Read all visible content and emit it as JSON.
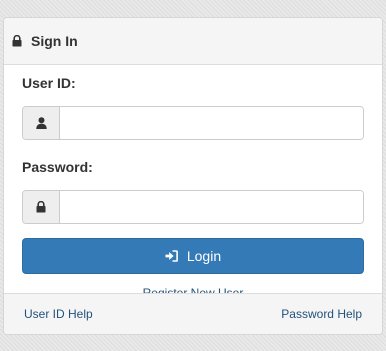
{
  "panel": {
    "title": "Sign In",
    "title_icon": "lock-icon"
  },
  "form": {
    "user_id_label": "User ID:",
    "user_id_value": "",
    "user_id_icon": "user-icon",
    "password_label": "Password:",
    "password_value": "",
    "password_icon": "lock-icon",
    "login_label": "Login",
    "login_icon": "sign-in-icon",
    "register_link": "Register New User"
  },
  "footer": {
    "user_id_help": "User ID Help",
    "password_help": "Password Help"
  },
  "colors": {
    "primary": "#337ab7",
    "link": "#23527c",
    "panel_heading_bg": "#f5f5f5"
  }
}
